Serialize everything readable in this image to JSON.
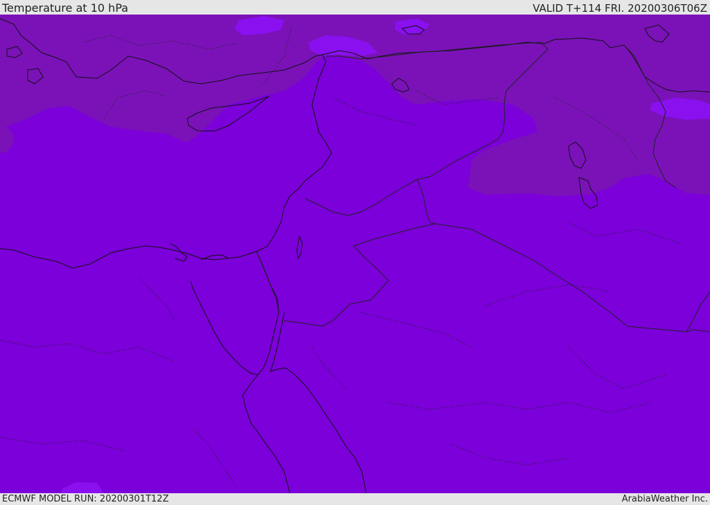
{
  "header": {
    "title": "Temperature at 10 hPa",
    "valid_time": "VALID T+114 FRI. 20200306T06Z"
  },
  "footer": {
    "model_run": "ECMWF MODEL RUN: 20200301T12Z",
    "credit": "ArabiaWeather Inc."
  },
  "map": {
    "colors": {
      "base_field": "#7b00d9",
      "cold_band": "#7a12b8",
      "warm_patch": "#8a10f0",
      "coastline": "#111111",
      "border": "#222222"
    }
  }
}
